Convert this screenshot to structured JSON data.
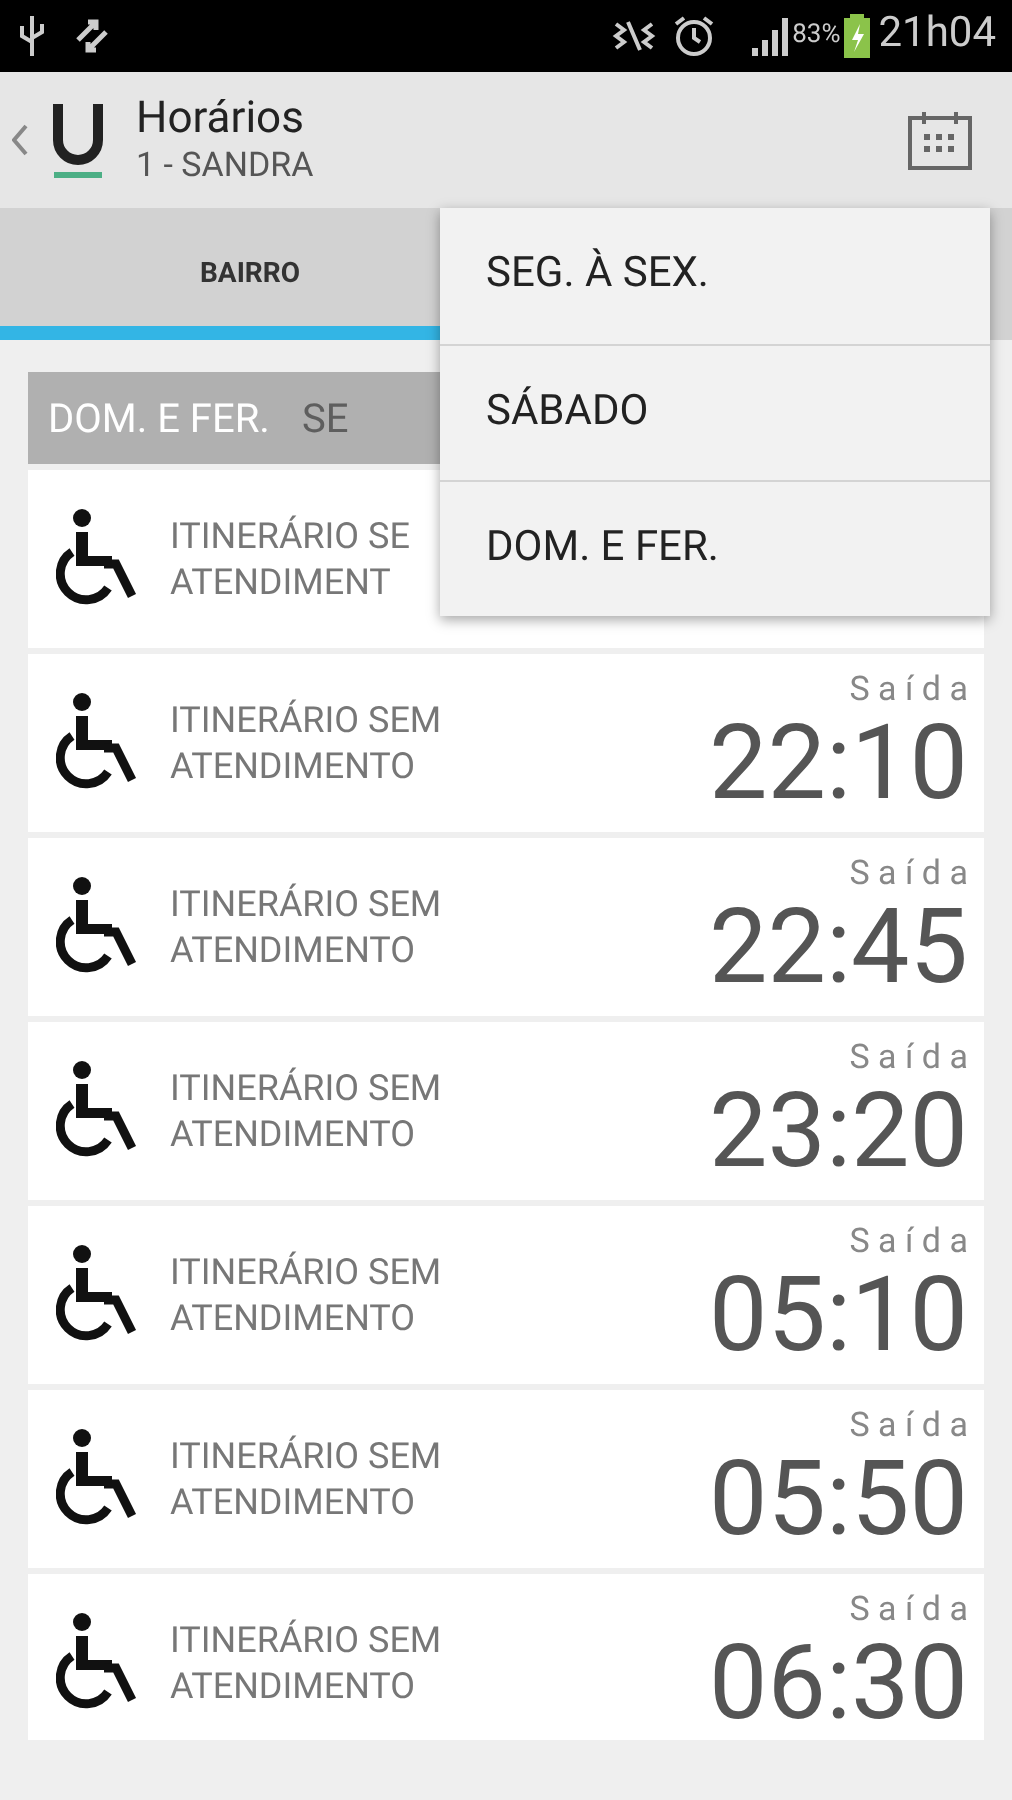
{
  "status_bar": {
    "battery": "83%",
    "time": "21h04"
  },
  "action_bar": {
    "title": "Horários",
    "subtitle": "1 - SANDRA"
  },
  "tabs": [
    {
      "label": "BAIRRO",
      "selected": true
    }
  ],
  "day_filter": [
    {
      "label": "DOM. E FER.",
      "selected": true
    },
    {
      "label": "SE",
      "selected": false
    }
  ],
  "departures": [
    {
      "description": [
        "ITINERÁRIO SE",
        "ATENDIMENT"
      ]
    },
    {
      "description": [
        "ITINERÁRIO SEM",
        "ATENDIMENTO"
      ],
      "label": "S a í d a",
      "time": "22:10"
    },
    {
      "description": [
        "ITINERÁRIO SEM",
        "ATENDIMENTO"
      ],
      "label": "S a í d a",
      "time": "22:45"
    },
    {
      "description": [
        "ITINERÁRIO SEM",
        "ATENDIMENTO"
      ],
      "label": "S a í d a",
      "time": "23:20"
    },
    {
      "description": [
        "ITINERÁRIO SEM",
        "ATENDIMENTO"
      ],
      "label": "S a í d a",
      "time": "05:10"
    },
    {
      "description": [
        "ITINERÁRIO SEM",
        "ATENDIMENTO"
      ],
      "label": "S a í d a",
      "time": "05:50"
    },
    {
      "description": [
        "ITINERÁRIO SEM",
        "ATENDIMENTO"
      ],
      "label": "S a í d a",
      "time": "06:30"
    }
  ],
  "menu": [
    {
      "label": "SEG. À SEX."
    },
    {
      "label": "SÁBADO"
    },
    {
      "label": "DOM. E FER."
    }
  ]
}
